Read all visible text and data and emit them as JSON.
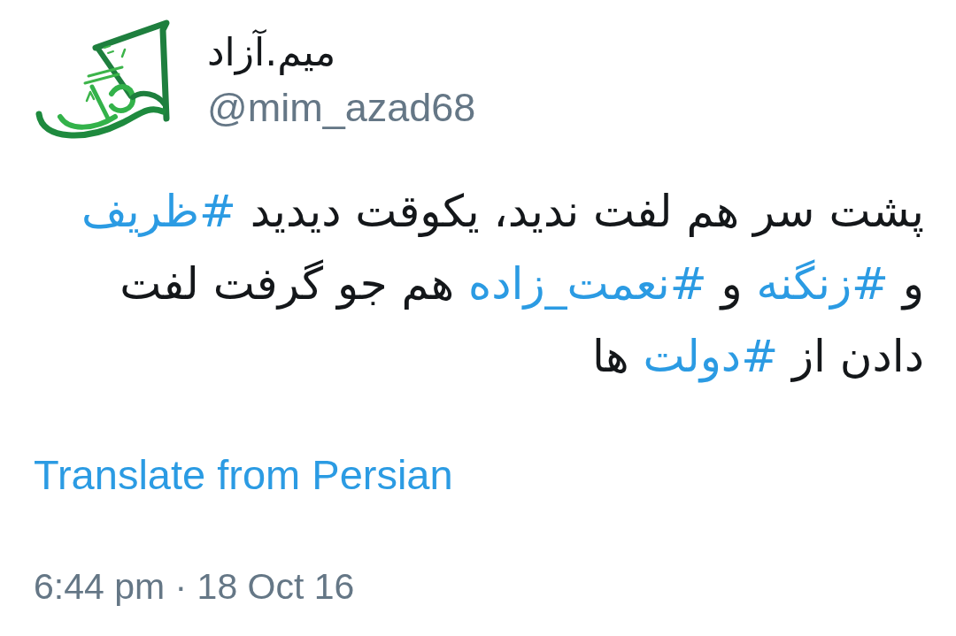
{
  "tweet": {
    "author": {
      "name": "میم.آزاد",
      "handle": "@mim_azad68"
    },
    "text": [
      {
        "kind": "text",
        "text": "پشت سر هم لفت ندید، یکوقت دیدید "
      },
      {
        "kind": "hashtag",
        "text": "#ظریف"
      },
      {
        "kind": "text",
        "text": " و "
      },
      {
        "kind": "hashtag",
        "text": "#زنگنه"
      },
      {
        "kind": "text",
        "text": " و "
      },
      {
        "kind": "hashtag",
        "text": "#نعمت_زاده"
      },
      {
        "kind": "text",
        "text": " هم جو گرفت لفت دادن از "
      },
      {
        "kind": "hashtag",
        "text": "#دولت"
      },
      {
        "kind": "text",
        "text": " ها"
      }
    ],
    "translate_link": "Translate from Persian",
    "timestamp": "6:44 pm · 18 Oct 16"
  }
}
